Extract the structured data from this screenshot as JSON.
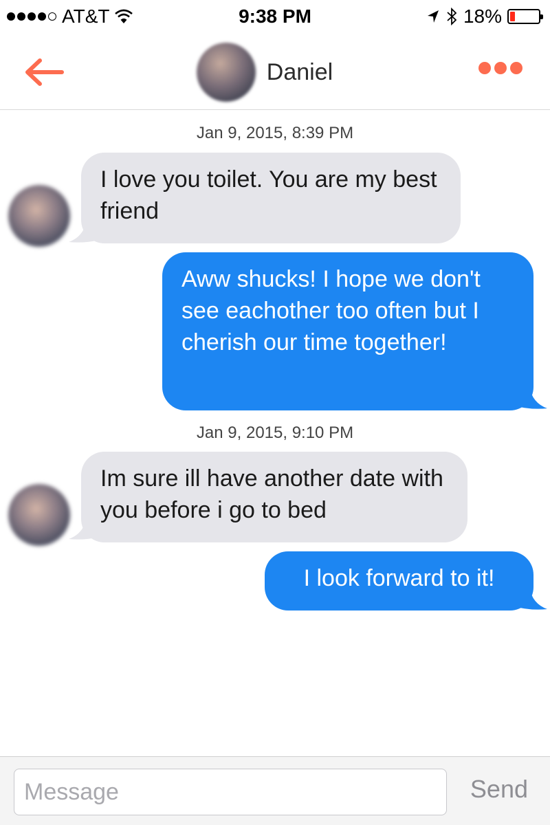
{
  "status_bar": {
    "carrier": "AT&T",
    "time": "9:38 PM",
    "battery_percent": "18%",
    "battery_level": 0.18,
    "icons": [
      "signal-dots-icon",
      "wifi-icon",
      "location-arrow-icon",
      "bluetooth-icon",
      "battery-icon"
    ]
  },
  "nav": {
    "contact_name": "Daniel",
    "back_icon": "arrow-left-icon",
    "more_icon": "more-dots-icon",
    "accent_color": "#fd6c4f"
  },
  "conversation": [
    {
      "type": "timestamp",
      "text": "Jan 9, 2015, 8:39 PM"
    },
    {
      "type": "incoming",
      "text": "I love you toilet. You are my best friend"
    },
    {
      "type": "outgoing",
      "text": "Aww shucks! I hope we don't see eachother too often but I cherish our time together!"
    },
    {
      "type": "timestamp",
      "text": "Jan 9, 2015, 9:10 PM"
    },
    {
      "type": "incoming",
      "text": "Im sure ill have another date with you before i go to bed"
    },
    {
      "type": "outgoing",
      "text": "I look forward to it!"
    }
  ],
  "composer": {
    "placeholder": "Message",
    "value": "",
    "send_label": "Send"
  },
  "colors": {
    "incoming_bubble": "#e5e5ea",
    "outgoing_bubble": "#1d86f2",
    "accent": "#fd6c4f"
  }
}
